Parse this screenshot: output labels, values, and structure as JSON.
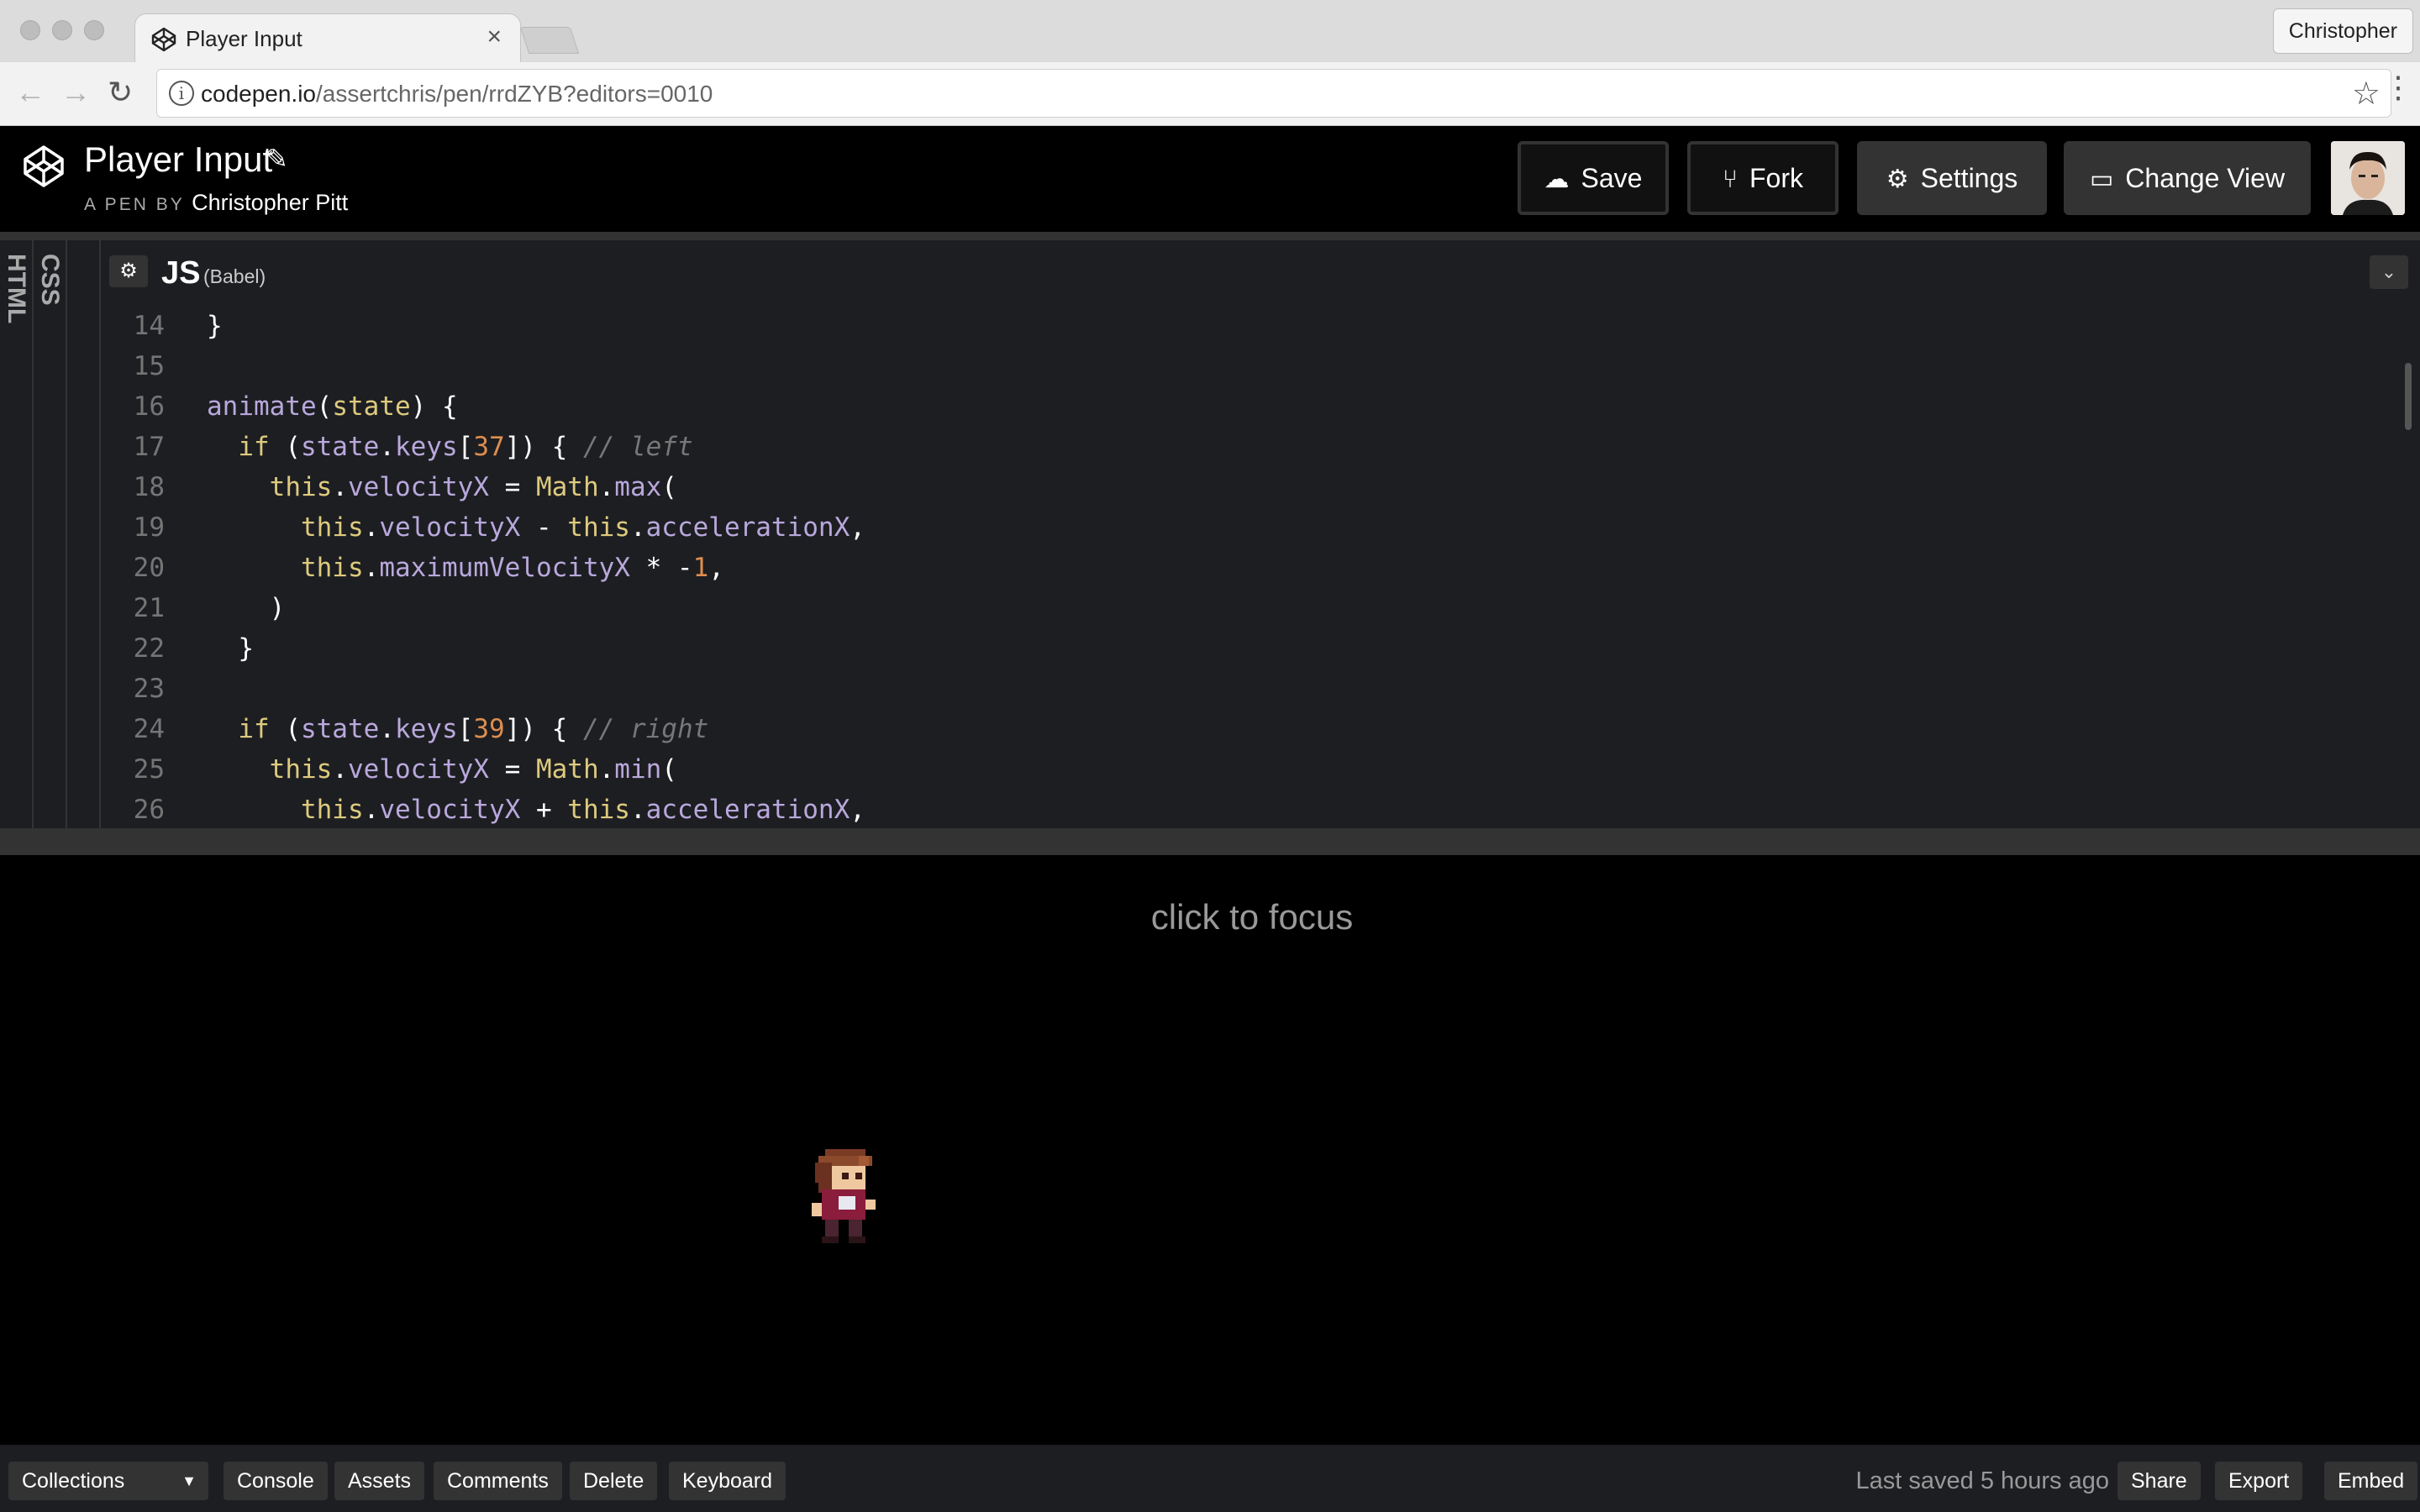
{
  "browser": {
    "tab_title": "Player Input",
    "profile_name": "Christopher",
    "url_host": "codepen.io",
    "url_path": "/assertchris/pen/rrdZYB?editors=0010"
  },
  "header": {
    "pen_title": "Player Input",
    "by_prefix": "A PEN BY ",
    "author": "Christopher Pitt",
    "buttons": {
      "save": "Save",
      "fork": "Fork",
      "settings": "Settings",
      "change_view": "Change View"
    }
  },
  "editor": {
    "collapsed_panels": [
      "HTML",
      "CSS"
    ],
    "active_label": "JS",
    "active_sub": "(Babel)",
    "lines": [
      {
        "n": "14",
        "parts": [
          {
            "t": "}",
            "c": ""
          }
        ]
      },
      {
        "n": "15",
        "parts": []
      },
      {
        "n": "16",
        "parts": [
          {
            "t": "animate",
            "c": "fn"
          },
          {
            "t": "(",
            "c": ""
          },
          {
            "t": "state",
            "c": "kw"
          },
          {
            "t": ") {",
            "c": ""
          }
        ]
      },
      {
        "n": "17",
        "parts": [
          {
            "t": "  ",
            "c": ""
          },
          {
            "t": "if",
            "c": "kw"
          },
          {
            "t": " (",
            "c": ""
          },
          {
            "t": "state",
            "c": "fn"
          },
          {
            "t": ".",
            "c": ""
          },
          {
            "t": "keys",
            "c": "fn"
          },
          {
            "t": "[",
            "c": ""
          },
          {
            "t": "37",
            "c": "num"
          },
          {
            "t": "]) { ",
            "c": ""
          },
          {
            "t": "// left",
            "c": "cm"
          }
        ]
      },
      {
        "n": "18",
        "parts": [
          {
            "t": "    ",
            "c": ""
          },
          {
            "t": "this",
            "c": "kw"
          },
          {
            "t": ".",
            "c": ""
          },
          {
            "t": "velocityX",
            "c": "fn"
          },
          {
            "t": " = ",
            "c": ""
          },
          {
            "t": "Math",
            "c": "kw"
          },
          {
            "t": ".",
            "c": ""
          },
          {
            "t": "max",
            "c": "fn"
          },
          {
            "t": "(",
            "c": ""
          }
        ]
      },
      {
        "n": "19",
        "parts": [
          {
            "t": "      ",
            "c": ""
          },
          {
            "t": "this",
            "c": "kw"
          },
          {
            "t": ".",
            "c": ""
          },
          {
            "t": "velocityX",
            "c": "fn"
          },
          {
            "t": " - ",
            "c": ""
          },
          {
            "t": "this",
            "c": "kw"
          },
          {
            "t": ".",
            "c": ""
          },
          {
            "t": "accelerationX",
            "c": "fn"
          },
          {
            "t": ",",
            "c": ""
          }
        ]
      },
      {
        "n": "20",
        "parts": [
          {
            "t": "      ",
            "c": ""
          },
          {
            "t": "this",
            "c": "kw"
          },
          {
            "t": ".",
            "c": ""
          },
          {
            "t": "maximumVelocityX",
            "c": "fn"
          },
          {
            "t": " * -",
            "c": ""
          },
          {
            "t": "1",
            "c": "num"
          },
          {
            "t": ",",
            "c": ""
          }
        ]
      },
      {
        "n": "21",
        "parts": [
          {
            "t": "    )",
            "c": ""
          }
        ]
      },
      {
        "n": "22",
        "parts": [
          {
            "t": "  }",
            "c": ""
          }
        ]
      },
      {
        "n": "23",
        "parts": []
      },
      {
        "n": "24",
        "parts": [
          {
            "t": "  ",
            "c": ""
          },
          {
            "t": "if",
            "c": "kw"
          },
          {
            "t": " (",
            "c": ""
          },
          {
            "t": "state",
            "c": "fn"
          },
          {
            "t": ".",
            "c": ""
          },
          {
            "t": "keys",
            "c": "fn"
          },
          {
            "t": "[",
            "c": ""
          },
          {
            "t": "39",
            "c": "num"
          },
          {
            "t": "]) { ",
            "c": ""
          },
          {
            "t": "// right",
            "c": "cm"
          }
        ]
      },
      {
        "n": "25",
        "parts": [
          {
            "t": "    ",
            "c": ""
          },
          {
            "t": "this",
            "c": "kw"
          },
          {
            "t": ".",
            "c": ""
          },
          {
            "t": "velocityX",
            "c": "fn"
          },
          {
            "t": " = ",
            "c": ""
          },
          {
            "t": "Math",
            "c": "kw"
          },
          {
            "t": ".",
            "c": ""
          },
          {
            "t": "min",
            "c": "fn"
          },
          {
            "t": "(",
            "c": ""
          }
        ]
      },
      {
        "n": "26",
        "parts": [
          {
            "t": "      ",
            "c": ""
          },
          {
            "t": "this",
            "c": "kw"
          },
          {
            "t": ".",
            "c": ""
          },
          {
            "t": "velocityX",
            "c": "fn"
          },
          {
            "t": " + ",
            "c": ""
          },
          {
            "t": "this",
            "c": "kw"
          },
          {
            "t": ".",
            "c": ""
          },
          {
            "t": "accelerationX",
            "c": "fn"
          },
          {
            "t": ",",
            "c": ""
          }
        ]
      }
    ]
  },
  "preview": {
    "focus_text": "click to focus"
  },
  "footer": {
    "collections": "Collections",
    "console": "Console",
    "assets": "Assets",
    "comments": "Comments",
    "delete": "Delete",
    "keyboard": "Keyboard",
    "last_saved": "Last saved 5 hours ago",
    "share": "Share",
    "export": "Export",
    "embed": "Embed"
  },
  "colors": {
    "keyword": "#ddca7e",
    "identifier": "#b9a8dc",
    "number": "#dd8e4f",
    "comment": "#777777",
    "editor_bg": "#1d1e22"
  }
}
